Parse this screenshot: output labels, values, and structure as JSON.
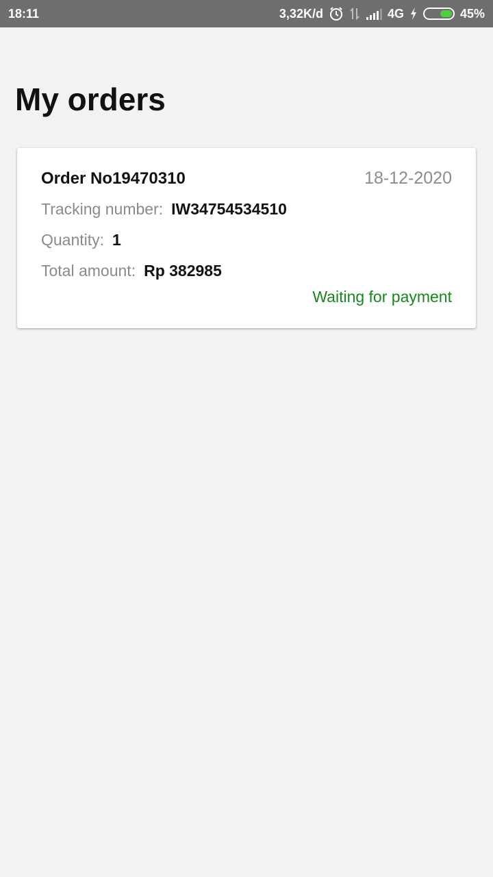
{
  "status_bar": {
    "time": "18:11",
    "net_speed": "3,32K/d",
    "network": "4G",
    "battery": "45%",
    "battery_level": 0.45,
    "battery_color": "#4cd13a",
    "icons": [
      "alarm-icon",
      "data-arrows-icon",
      "signal-icon",
      "charging-icon",
      "battery-icon"
    ]
  },
  "page": {
    "title": "My orders"
  },
  "orders": [
    {
      "order_no": "Order No19470310",
      "date": "18-12-2020",
      "tracking_label": "Tracking number:",
      "tracking_value": "IW34754534510",
      "quantity_label": "Quantity:",
      "quantity_value": "1",
      "total_label": "Total amount:",
      "total_value": "Rp 382985",
      "status": "Waiting for payment",
      "status_color": "#128a1a"
    }
  ]
}
